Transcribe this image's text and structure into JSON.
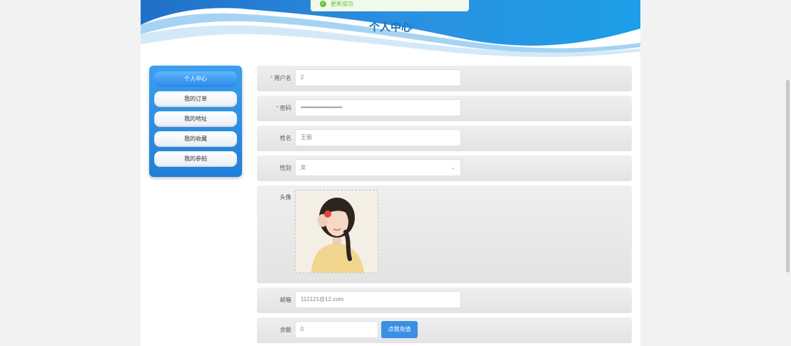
{
  "toast": {
    "message": "更新成功",
    "icon": "check-circle-icon",
    "color": "#67c23a"
  },
  "page_title": "个人中心",
  "sidebar": {
    "items": [
      {
        "label": "个人中心",
        "active": true
      },
      {
        "label": "我的订单",
        "active": false
      },
      {
        "label": "我的地址",
        "active": false
      },
      {
        "label": "我的收藏",
        "active": false
      },
      {
        "label": "我的参拍",
        "active": false
      }
    ]
  },
  "form": {
    "username": {
      "label": "用户名",
      "required": true,
      "value": "2"
    },
    "password": {
      "label": "密码",
      "required": true,
      "value": "••••••••••••••••••••••••••••••••"
    },
    "name": {
      "label": "姓名",
      "value": "王丽"
    },
    "gender": {
      "label": "性别",
      "value": "女"
    },
    "avatar": {
      "label": "头像"
    },
    "email": {
      "label": "邮箱",
      "value": "112121@12.com"
    },
    "balance": {
      "label": "余额",
      "value": "0",
      "button": "点我充值"
    }
  },
  "colors": {
    "accent": "#1f7fd6",
    "title": "#1a6fb5",
    "button": "#3a8ee6"
  }
}
